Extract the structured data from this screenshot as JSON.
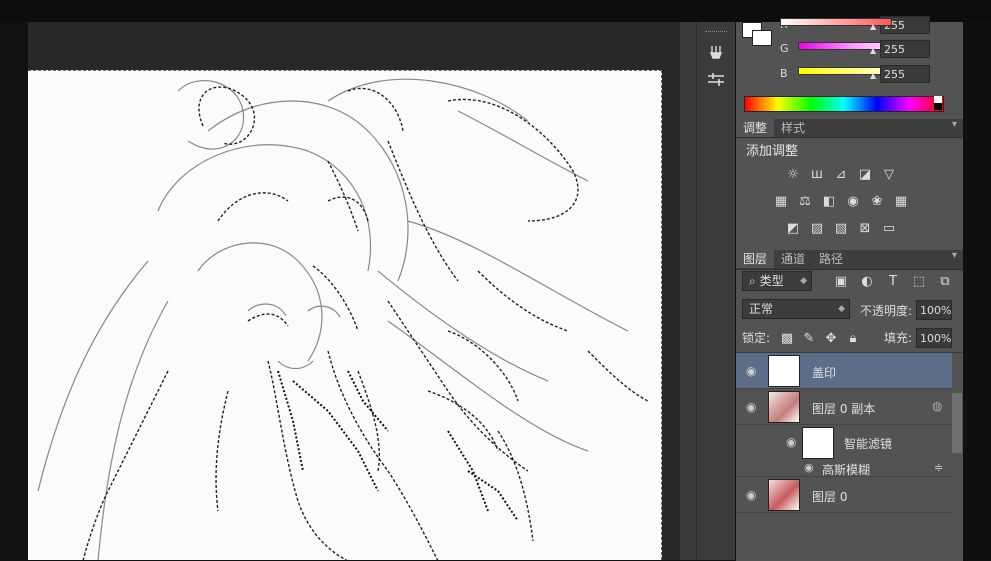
{
  "colors": {
    "accent": "#5c6d88",
    "panel": "#535353",
    "dark": "#282828"
  },
  "color_panel": {
    "channels": [
      {
        "label": "R",
        "value": "255",
        "gradient": "linear-gradient(90deg,#fff,#f55)"
      },
      {
        "label": "G",
        "value": "255",
        "gradient": "linear-gradient(90deg,#e0e,#f9f,#fff)"
      },
      {
        "label": "B",
        "value": "255",
        "gradient": "linear-gradient(90deg,#ff0,#fff)"
      }
    ]
  },
  "adjust_tabs": [
    {
      "label": "调整",
      "active": true
    },
    {
      "label": "样式",
      "active": false
    }
  ],
  "adjust_title": "添加调整",
  "layer_tabs": [
    {
      "label": "图层",
      "active": true
    },
    {
      "label": "通道",
      "active": false
    },
    {
      "label": "路径",
      "active": false
    }
  ],
  "layers_panel": {
    "filter_kind": "类型",
    "blend_mode": "正常",
    "opacity_label": "不透明度:",
    "opacity_value": "100%",
    "lock_label": "锁定:",
    "fill_label": "填充:",
    "fill_value": "100%"
  },
  "layers": [
    {
      "name": "盖印",
      "selected": true
    },
    {
      "name": "图层 0 副本",
      "selected": false
    },
    {
      "name": "智能滤镜",
      "selected": false
    },
    {
      "name": "高斯模糊",
      "selected": false
    },
    {
      "name": "图层 0",
      "selected": false
    }
  ],
  "icons": [
    "brush-tool-icon",
    "adjust-tool-icon",
    "eye-icon",
    "lock-icon",
    "link-icon",
    "collapse-menu-icon"
  ]
}
